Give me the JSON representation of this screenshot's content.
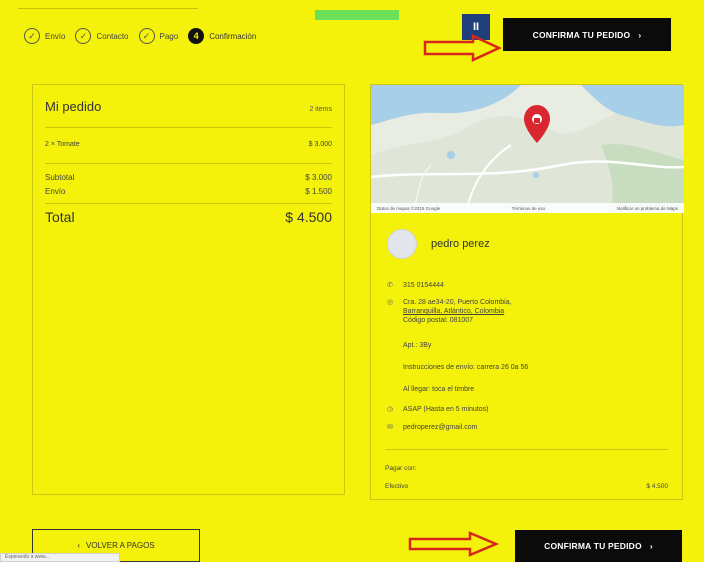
{
  "steps": [
    {
      "label": "Envío",
      "icon": "check-circle-icon",
      "symbol": "✓"
    },
    {
      "label": "Contacto",
      "icon": "check-circle-icon",
      "symbol": "✓"
    },
    {
      "label": "Pago",
      "icon": "check-circle-icon",
      "symbol": "✓"
    },
    {
      "label": "Confirmación",
      "icon": "step-number",
      "symbol": "4"
    }
  ],
  "header": {
    "pause_symbol": "II",
    "confirm_label": "CONFIRMA TU PEDIDO",
    "confirm_chevron": "›"
  },
  "order": {
    "title": "Mi pedido",
    "count": "2 items",
    "items": [
      {
        "name": "2 ×  Tomate",
        "price": "$ 3.000"
      }
    ],
    "subtotal_label": "Subtotal",
    "subtotal_value": "$ 3.000",
    "shipping_label": "Envío",
    "shipping_value": "$ 1.500",
    "total_label": "Total",
    "total_value": "$ 4.500"
  },
  "map": {
    "footer_left": "Datos de mapas ©2019 Google",
    "footer_mid": "Términos de uso",
    "footer_right": "Notificar un problema de Maps"
  },
  "contact": {
    "name": "pedro perez",
    "phone": "315 0154444",
    "address_line1": "Cra. 28 ae34-20, Puerto Colombia,",
    "address_line2": "Barranquilla, Atlántico, Colombia",
    "postal": "Código postal: 081007",
    "apt": "Apt.: 3By",
    "instructions": "Instrucciones de envío: carrera 26 0a 56",
    "arrival": "Al llegar: toca el timbre",
    "timing": "ASAP (Hasta en 5 minutos)",
    "email": "pedroperez@gmail.com"
  },
  "payment": {
    "label": "Pagar con:",
    "method": "Efectivo",
    "amount": "$ 4.500"
  },
  "footer": {
    "back_chevron": "‹",
    "back_label": "VOLVER A PAGOS",
    "confirm_label": "CONFIRMA TU PEDIDO",
    "confirm_chevron": "›",
    "status_text": "Esperando a www..."
  },
  "colors": {
    "background": "#f4f20a",
    "button": "#0b0b0b",
    "arrow": "#d9261c",
    "pin": "#d9262f",
    "pause_button": "#1f3f7a"
  }
}
